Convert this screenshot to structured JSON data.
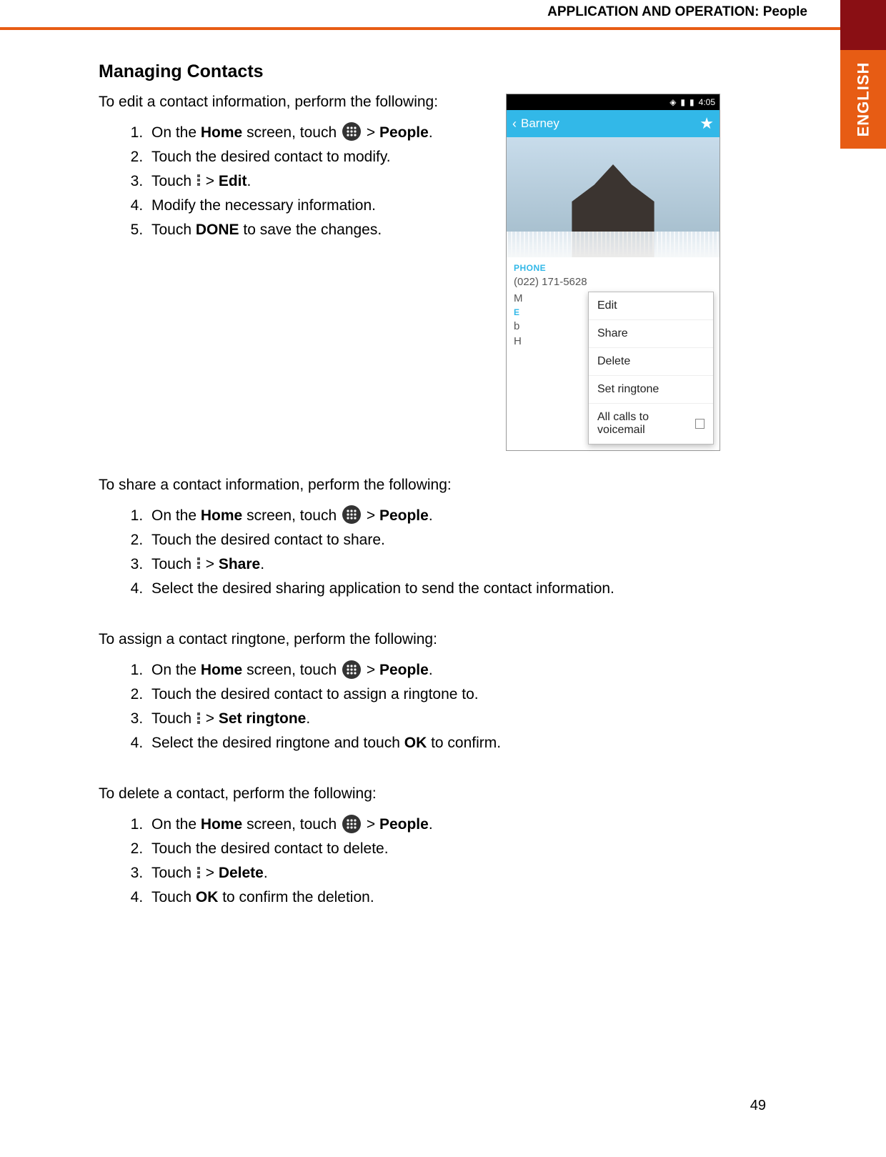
{
  "header": {
    "section_title": "APPLICATION AND OPERATION: People",
    "side_tab": "ENGLISH"
  },
  "page_number": "49",
  "title": "Managing Contacts",
  "edit": {
    "intro": "To edit a contact information, perform the following:",
    "steps": {
      "s1a": "On the ",
      "s1_home": "Home",
      "s1b": " screen, touch ",
      "s1c": " > ",
      "s1_people": "People",
      "s1d": ".",
      "s2": "Touch the desired contact to modify.",
      "s3a": "Touch ",
      "s3b": " > ",
      "s3_edit": "Edit",
      "s3c": ".",
      "s4": "Modify the necessary information.",
      "s5a": "Touch ",
      "s5_done": "DONE",
      "s5b": " to save the changes."
    }
  },
  "share": {
    "intro": "To share a contact information, perform the following:",
    "steps": {
      "s1a": "On the ",
      "s1_home": "Home",
      "s1b": " screen, touch ",
      "s1c": " > ",
      "s1_people": "People",
      "s1d": ".",
      "s2": "Touch the desired contact to share.",
      "s3a": "Touch ",
      "s3b": " > ",
      "s3_share": "Share",
      "s3c": ".",
      "s4": "Select the desired sharing application to send the contact information."
    }
  },
  "ringtone": {
    "intro": "To assign a contact ringtone, perform the following:",
    "steps": {
      "s1a": "On the ",
      "s1_home": "Home",
      "s1b": " screen, touch ",
      "s1c": " > ",
      "s1_people": "People",
      "s1d": ".",
      "s2": "Touch the desired contact to assign a ringtone to.",
      "s3a": "Touch ",
      "s3b": " > ",
      "s3_set": "Set ringtone",
      "s3c": ".",
      "s4a": "Select the desired ringtone and touch ",
      "s4_ok": "OK",
      "s4b": " to confirm."
    }
  },
  "delete": {
    "intro": "To delete a contact, perform the following:",
    "steps": {
      "s1a": "On the ",
      "s1_home": "Home",
      "s1b": " screen, touch ",
      "s1c": " > ",
      "s1_people": "People",
      "s1d": ".",
      "s2": "Touch the desired contact to delete.",
      "s3a": "Touch ",
      "s3b": " > ",
      "s3_del": "Delete",
      "s3c": ".",
      "s4a": "Touch ",
      "s4_ok": "OK",
      "s4b": " to confirm the deletion."
    }
  },
  "phone": {
    "time": "4:05",
    "contact_name": "Barney",
    "phone_label": "PHONE",
    "phone_number": "(022) 171-5628",
    "left_m": "M",
    "left_e": "E",
    "left_b": "b",
    "left_h": "H",
    "menu": {
      "edit": "Edit",
      "share": "Share",
      "delete": "Delete",
      "set_ringtone": "Set ringtone",
      "voicemail": "All calls to voicemail"
    }
  }
}
